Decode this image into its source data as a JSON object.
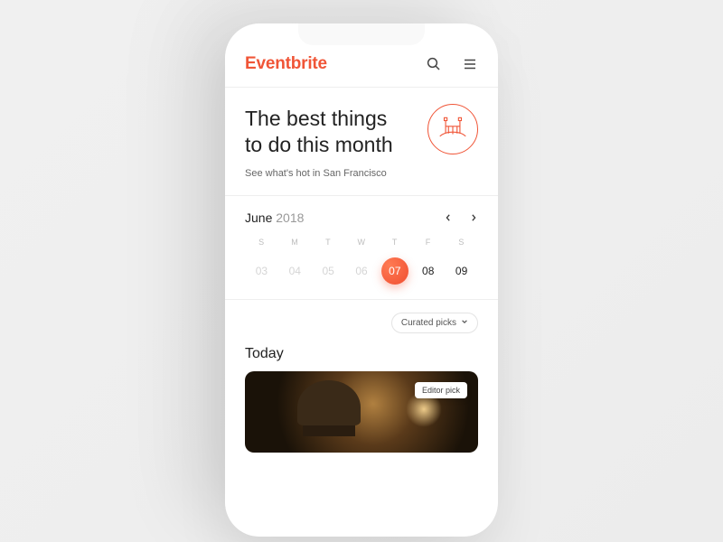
{
  "brand": {
    "name": "Eventbrite",
    "color": "#f05537"
  },
  "hero": {
    "title": "The best things to do this month",
    "subtitle": "See what's hot in San Francisco",
    "city_icon": "golden-gate-bridge"
  },
  "calendar": {
    "month": "June",
    "year": "2018",
    "dow": [
      "S",
      "M",
      "T",
      "W",
      "T",
      "F",
      "S"
    ],
    "days": [
      {
        "n": "03",
        "dim": true
      },
      {
        "n": "04",
        "dim": true
      },
      {
        "n": "05",
        "dim": true
      },
      {
        "n": "06",
        "dim": true
      },
      {
        "n": "07",
        "selected": true
      },
      {
        "n": "08"
      },
      {
        "n": "09"
      }
    ]
  },
  "filter": {
    "label": "Curated picks"
  },
  "section": {
    "today": "Today"
  },
  "card": {
    "badge": "Editor pick"
  }
}
